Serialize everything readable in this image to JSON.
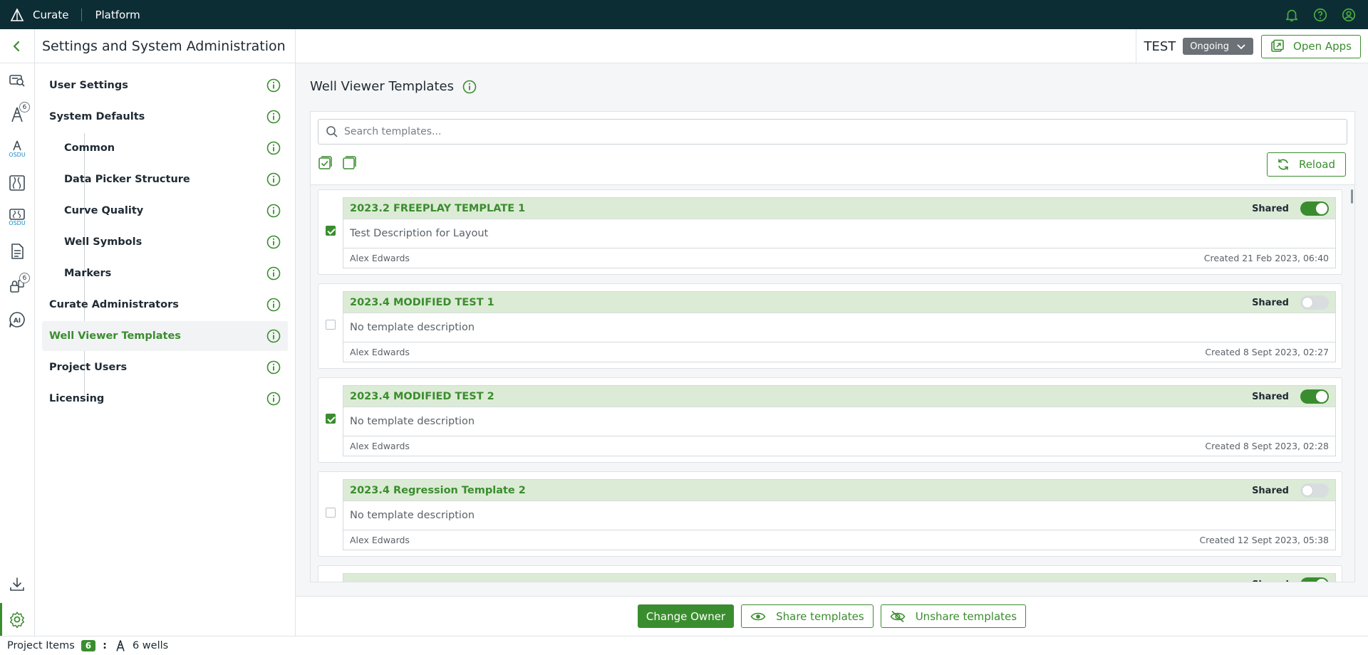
{
  "topbar": {
    "brand": "Curate",
    "platform": "Platform"
  },
  "rail": {
    "wells_badge": "6",
    "locked_badge": "6",
    "osdu_label": "OSDU",
    "ai_label": "AI"
  },
  "settings": {
    "title": "Settings and System Administration",
    "nav": [
      {
        "label": "User Settings",
        "sub": false,
        "active": false
      },
      {
        "label": "System Defaults",
        "sub": false,
        "active": false
      },
      {
        "label": "Common",
        "sub": true,
        "active": false
      },
      {
        "label": "Data Picker Structure",
        "sub": true,
        "active": false
      },
      {
        "label": "Curve Quality",
        "sub": true,
        "active": false
      },
      {
        "label": "Well Symbols",
        "sub": true,
        "active": false
      },
      {
        "label": "Markers",
        "sub": true,
        "active": false
      },
      {
        "label": "Curate Administrators",
        "sub": false,
        "active": false
      },
      {
        "label": "Well Viewer Templates",
        "sub": false,
        "active": true
      },
      {
        "label": "Project Users",
        "sub": false,
        "active": false
      },
      {
        "label": "Licensing",
        "sub": false,
        "active": false
      }
    ]
  },
  "project": {
    "name": "TEST",
    "status": "Ongoing",
    "open_apps_label": "Open Apps"
  },
  "main": {
    "title": "Well Viewer Templates",
    "search_placeholder": "Search templates...",
    "reload_label": "Reload",
    "shared_label": "Shared",
    "templates": [
      {
        "title": "2023.2 FREEPLAY TEMPLATE 1",
        "description": "Test Description for Layout",
        "owner": "Alex Edwards",
        "created": "Created 21 Feb 2023, 06:40",
        "checked": true,
        "shared": true
      },
      {
        "title": "2023.4 MODIFIED TEST 1",
        "description": "No template description",
        "owner": "Alex Edwards",
        "created": "Created 8 Sept 2023, 02:27",
        "checked": false,
        "shared": false
      },
      {
        "title": "2023.4 MODIFIED TEST 2",
        "description": "No template description",
        "owner": "Alex Edwards",
        "created": "Created 8 Sept 2023, 02:28",
        "checked": true,
        "shared": true
      },
      {
        "title": "2023.4 Regression Template 2",
        "description": "No template description",
        "owner": "Alex Edwards",
        "created": "Created 12 Sept 2023, 05:38",
        "checked": false,
        "shared": false
      },
      {
        "title": "",
        "description": "",
        "owner": "",
        "created": "",
        "checked": false,
        "shared": true
      }
    ]
  },
  "footer": {
    "change_owner": "Change Owner",
    "share": "Share templates",
    "unshare": "Unshare templates"
  },
  "statusbar": {
    "label": "Project Items",
    "count": "6",
    "separator": ":",
    "wells": "6 wells"
  },
  "colors": {
    "accent": "#3a8d2e",
    "topbar": "#0d2d35",
    "card_header": "#dcebd6"
  }
}
